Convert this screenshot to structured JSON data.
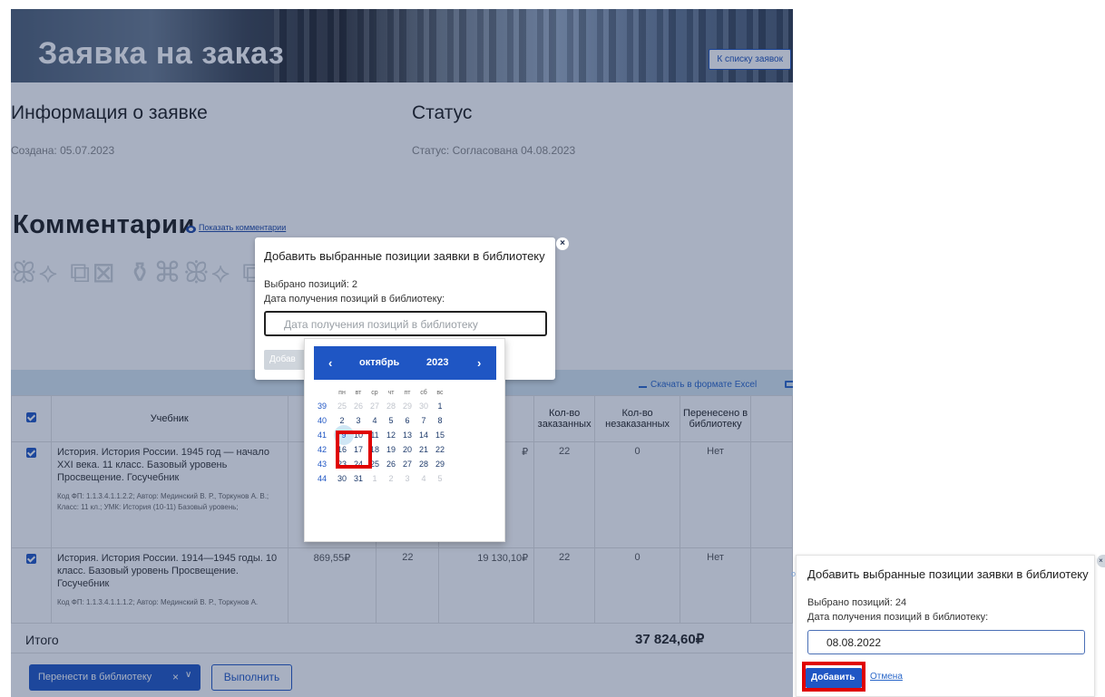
{
  "header": {
    "title": "Заявка на заказ",
    "back_button": "К списку заявок"
  },
  "info": {
    "title": "Информация о заявке",
    "created": "Создана: 05.07.2023"
  },
  "status": {
    "title": "Статус",
    "text": "Статус: Согласована 04.08.2023"
  },
  "comments": {
    "title": "Комментарии",
    "show_link": "Показать комментарии"
  },
  "ornament": "ꕥ⟡ ⧉⊠ ⚱⌘ꕥ⟡ ⧉⊠ ⚱⌘ꕥ⟡ ⧉⊠ ⚱⌘",
  "table": {
    "excel_link": "Скачать в формате Excel",
    "columns": [
      "Учебник",
      "",
      "",
      "",
      "Кол-во заказанных",
      "Кол-во незаказанных",
      "Перенесено в библиотеку"
    ],
    "rows": [
      {
        "title": "История. История России. 1945 год — начало XXI века. 11 класс. Базовый уровень Просвещение. Госучебник",
        "meta": "Код ФП: 1.1.3.4.1.1.2.2; Автор: Мединский В. Р., Торкунов А. В.; Класс: 11 кл.; УМК: История (10-11) Базовый уровень;",
        "price": "",
        "qty": "",
        "sum": "₽",
        "ordered": "22",
        "not_ordered": "0",
        "transferred": "Нет"
      },
      {
        "title": "История. История России. 1914—1945 годы. 10 класс. Базовый уровень Просвещение. Госучебник",
        "meta": "Код ФП: 1.1.3.4.1.1.1.2; Автор: Мединский В. Р., Торкунов А.",
        "price": "869,55₽",
        "qty": "22",
        "sum": "19 130,10₽",
        "ordered": "22",
        "not_ordered": "0",
        "transferred": "Нет"
      }
    ],
    "total_label": "Итого",
    "total_value": "37 824,60₽"
  },
  "actions": {
    "select_value": "Перенести в библиотеку",
    "clear": "×",
    "chevron": "∨",
    "run_button": "Выполнить"
  },
  "dialog": {
    "title": "Добавить выбранные позиции заявки в библиотеку",
    "count": "Выбрано позиций: 2",
    "date_label": "Дата получения позиций в библиотеку:",
    "date_placeholder": "Дата получения позиций в библиотеку",
    "add_button": "Добав",
    "close": "×"
  },
  "calendar": {
    "prev": "‹",
    "next": "›",
    "month": "октябрь",
    "year": "2023",
    "weekdays": [
      "пн",
      "вт",
      "ср",
      "чт",
      "пт",
      "сб",
      "вс"
    ],
    "weeks": [
      {
        "wk": "39",
        "days": [
          "25",
          "26",
          "27",
          "28",
          "29",
          "30",
          "1"
        ]
      },
      {
        "wk": "40",
        "days": [
          "2",
          "3",
          "4",
          "5",
          "6",
          "7",
          "8"
        ]
      },
      {
        "wk": "41",
        "days": [
          "9",
          "10",
          "11",
          "12",
          "13",
          "14",
          "15"
        ]
      },
      {
        "wk": "42",
        "days": [
          "16",
          "17",
          "18",
          "19",
          "20",
          "21",
          "22"
        ]
      },
      {
        "wk": "43",
        "days": [
          "23",
          "24",
          "25",
          "26",
          "27",
          "28",
          "29"
        ]
      },
      {
        "wk": "44",
        "days": [
          "30",
          "31",
          "1",
          "2",
          "3",
          "4",
          "5"
        ]
      }
    ],
    "selected_day": "9"
  },
  "dialog2": {
    "title": "Добавить выбранные позиции заявки в библиотеку",
    "count": "Выбрано позиций: 24",
    "date_label": "Дата получения позиций в библиотеку:",
    "date_value": "08.08.2022",
    "add_button": "Добавить",
    "cancel_link": "Отмена",
    "close": "×",
    "side_fragment": "о"
  },
  "colors": {
    "accent": "#1f56c4",
    "highlight": "#e00000",
    "table_bar": "#d7e7f1"
  }
}
